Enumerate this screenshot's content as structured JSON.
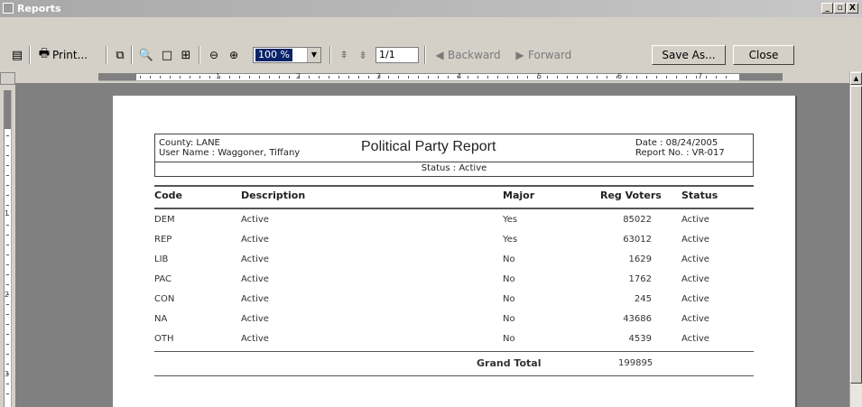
{
  "window": {
    "title": "Reports",
    "min": "_",
    "max": "▫",
    "close": "X"
  },
  "toolbar": {
    "print_label": "Print...",
    "zoom_value": "100 %",
    "page_value": "1/1",
    "backward_label": "Backward",
    "forward_label": "Forward",
    "save_as_label": "Save As...",
    "close_label": "Close"
  },
  "ruler": {
    "h_labels": [
      "1",
      "2",
      "3",
      "4",
      "5",
      "6",
      "7"
    ],
    "v_labels": [
      "1",
      "2",
      "3"
    ]
  },
  "report": {
    "county": "County: LANE",
    "user": "User Name : Waggoner, Tiffany",
    "title": "Political Party Report",
    "date": "Date : 08/24/2005",
    "report_no": "Report No. : VR-017",
    "status": "Status : Active",
    "headers": {
      "code": "Code",
      "description": "Description",
      "major": "Major",
      "reg_voters": "Reg Voters",
      "status": "Status"
    },
    "rows": [
      {
        "code": "DEM",
        "description": "Active",
        "major": "Yes",
        "reg_voters": "85022",
        "status": "Active"
      },
      {
        "code": "REP",
        "description": "Active",
        "major": "Yes",
        "reg_voters": "63012",
        "status": "Active"
      },
      {
        "code": "LIB",
        "description": "Active",
        "major": "No",
        "reg_voters": "1629",
        "status": "Active"
      },
      {
        "code": "PAC",
        "description": "Active",
        "major": "No",
        "reg_voters": "1762",
        "status": "Active"
      },
      {
        "code": "CON",
        "description": "Active",
        "major": "No",
        "reg_voters": "245",
        "status": "Active"
      },
      {
        "code": "NA",
        "description": "Active",
        "major": "No",
        "reg_voters": "43686",
        "status": "Active"
      },
      {
        "code": "OTH",
        "description": "Active",
        "major": "No",
        "reg_voters": "4539",
        "status": "Active"
      }
    ],
    "grand_total_label": "Grand Total",
    "grand_total_value": "199895"
  }
}
